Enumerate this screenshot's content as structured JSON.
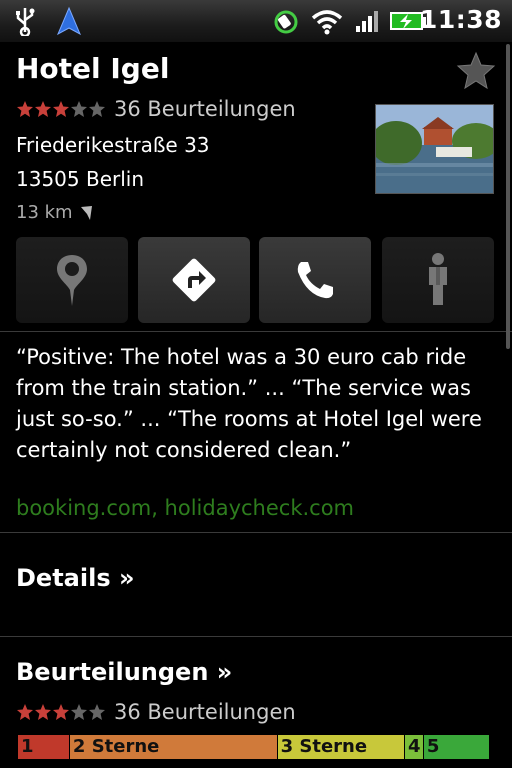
{
  "status_bar": {
    "time": "11:38",
    "icons": [
      "usb-icon",
      "navigation-icon",
      "sync-icon",
      "wifi-icon",
      "signal-icon",
      "battery-charging-icon"
    ]
  },
  "place": {
    "name": "Hotel Igel",
    "rating_stars": 3,
    "rating_max": 5,
    "review_count_label": "36 Beurteilungen",
    "address_line1": "Friederikestraße 33",
    "address_line2": "13505 Berlin",
    "distance": "13 km"
  },
  "actions": [
    {
      "name": "map-action-button",
      "icon": "map-pin-icon"
    },
    {
      "name": "directions-action-button",
      "icon": "directions-icon"
    },
    {
      "name": "call-action-button",
      "icon": "phone-icon"
    },
    {
      "name": "streetview-action-button",
      "icon": "pegman-icon"
    }
  ],
  "review": {
    "snippet": "“Positive: The hotel was a 30 euro cab ride from the train station.” ... “The service was just so-so.” ... “The rooms at Hotel Igel were certainly not considered clean.”",
    "sources": "booking.com, holidaycheck.com"
  },
  "details_link": "Details »",
  "reviews_section": {
    "title": "Beurteilungen »",
    "rating_stars": 3,
    "review_count_label": "36 Beurteilungen",
    "distribution": [
      {
        "label": "1",
        "share": 0.11,
        "color": "#c0392b"
      },
      {
        "label": "2 Sterne",
        "share": 0.44,
        "color": "#d07a3a"
      },
      {
        "label": "3 Sterne",
        "share": 0.27,
        "color": "#c8c83a"
      },
      {
        "label": "4",
        "share": 0.04,
        "color": "#7bbf3a"
      },
      {
        "label": "5",
        "share": 0.14,
        "color": "#3aa83a"
      }
    ]
  },
  "colors": {
    "star_filled": "#c8403a",
    "star_empty": "#666666",
    "source_link": "#2e7d1e"
  }
}
